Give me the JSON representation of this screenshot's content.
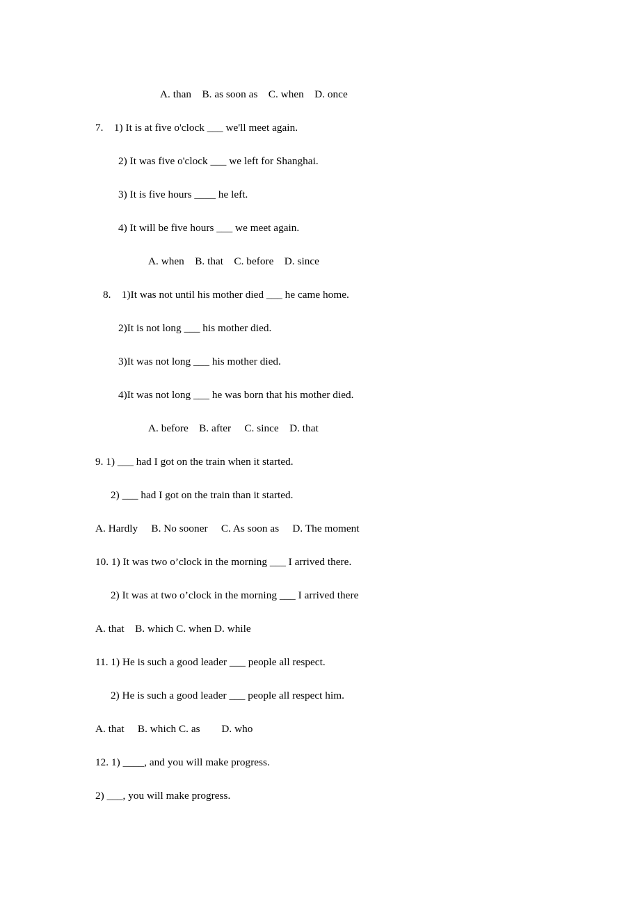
{
  "document": {
    "type": "grammar-exercise-worksheet",
    "background_color": "#ffffff",
    "text_color": "#000000",
    "lines": [
      {
        "id": "q6-options",
        "role": "options",
        "indent": 93,
        "text": "A. than    B. as soon as    C. when    D. once"
      },
      {
        "id": "q7-item1",
        "role": "question",
        "indent": 0,
        "text": "7.    1) It is at five o'clock ___ we'll meet again."
      },
      {
        "id": "q7-item2",
        "role": "question",
        "indent": 33,
        "text": "2) It was five o'clock ___ we left for Shanghai."
      },
      {
        "id": "q7-item3",
        "role": "question",
        "indent": 33,
        "text": "3) It is five hours ____ he left."
      },
      {
        "id": "q7-item4",
        "role": "question",
        "indent": 33,
        "text": "4) It will be five hours ___ we meet again."
      },
      {
        "id": "q7-options",
        "role": "options",
        "indent": 76,
        "text": "A. when    B. that    C. before    D. since"
      },
      {
        "id": "q8-item1",
        "role": "question",
        "indent": 11,
        "text": "8.    1)It was not until his mother died ___ he came home."
      },
      {
        "id": "q8-item2",
        "role": "question",
        "indent": 33,
        "text": "2)It is not long ___ his mother died."
      },
      {
        "id": "q8-item3",
        "role": "question",
        "indent": 33,
        "text": "3)It was not long ___ his mother died."
      },
      {
        "id": "q8-item4",
        "role": "question",
        "indent": 33,
        "text": "4)It was not long ___ he was born that his mother died."
      },
      {
        "id": "q8-options",
        "role": "options",
        "indent": 76,
        "text": "A. before    B. after     C. since    D. that"
      },
      {
        "id": "q9-item1",
        "role": "question",
        "indent": 0,
        "text": "9. 1) ___ had I got on the train when it started."
      },
      {
        "id": "q9-item2",
        "role": "question",
        "indent": 22,
        "text": "2) ___ had I got on the train than it started."
      },
      {
        "id": "q9-options",
        "role": "options",
        "indent": 0,
        "text": "A. Hardly     B. No sooner     C. As soon as     D. The moment"
      },
      {
        "id": "q10-item1",
        "role": "question",
        "indent": 0,
        "text": "10. 1) It was two o’clock in the morning ___ I arrived there."
      },
      {
        "id": "q10-item2",
        "role": "question",
        "indent": 22,
        "text": "2) It was at two o’clock in the morning ___ I arrived there"
      },
      {
        "id": "q10-options",
        "role": "options",
        "indent": 0,
        "text": "A. that    B. which C. when D. while"
      },
      {
        "id": "q11-item1",
        "role": "question",
        "indent": 0,
        "text": "11. 1) He is such a good leader ___ people all respect."
      },
      {
        "id": "q11-item2",
        "role": "question",
        "indent": 22,
        "text": "2) He is such a good leader ___ people all respect him."
      },
      {
        "id": "q11-options",
        "role": "options",
        "indent": 0,
        "text": "A. that     B. which C. as        D. who"
      },
      {
        "id": "q12-item1",
        "role": "question",
        "indent": 0,
        "text": "12. 1) ____, and you will make progress."
      },
      {
        "id": "q12-item2",
        "role": "question",
        "indent": 0,
        "text": "2) ___, you will make progress."
      }
    ]
  }
}
